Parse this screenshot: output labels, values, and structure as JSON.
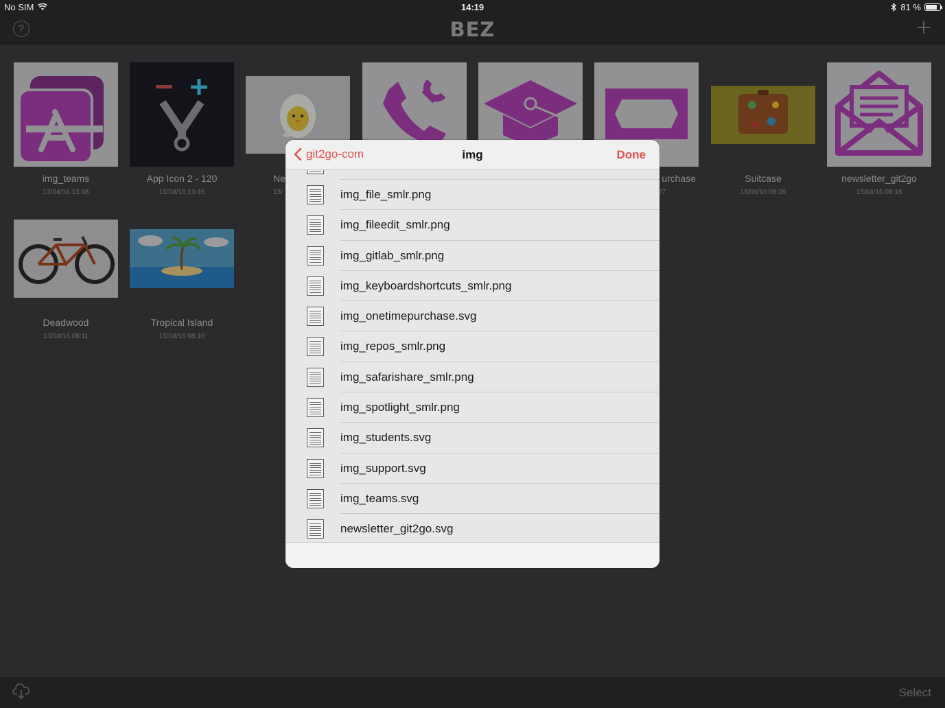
{
  "status_bar": {
    "carrier": "No SIM",
    "time": "14:19",
    "battery": "81 %",
    "battery_level": 0.81
  },
  "nav": {
    "logo": "BEZ",
    "help_label": "?"
  },
  "tiles": [
    {
      "name": "img_teams",
      "date": "13/04/16 13:48"
    },
    {
      "name": "App Icon 2 - 120",
      "date": "13/04/16 13:45"
    },
    {
      "name": "Ne",
      "date": "13/"
    },
    {
      "name": "",
      "date": ""
    },
    {
      "name": "",
      "date": ""
    },
    {
      "name": "urchase",
      "date": ":27"
    },
    {
      "name": "Suitcase",
      "date": "13/04/16 08:26"
    },
    {
      "name": "newsletter_git2go",
      "date": "13/04/16 08:18"
    },
    {
      "name": "Deadwood",
      "date": "13/04/16 08:11"
    },
    {
      "name": "Tropical Island",
      "date": "13/04/16 08:10"
    }
  ],
  "modal": {
    "back_label": "git2go-com",
    "title": "img",
    "done_label": "Done",
    "files": [
      "img_file_smlr.png",
      "img_fileedit_smlr.png",
      "img_gitlab_smlr.png",
      "img_keyboardshortcuts_smlr.png",
      "img_onetimepurchase.svg",
      "img_repos_smlr.png",
      "img_safarishare_smlr.png",
      "img_spotlight_smlr.png",
      "img_students.svg",
      "img_support.svg",
      "img_teams.svg",
      "newsletter_git2go.svg"
    ]
  },
  "bottom_bar": {
    "select_label": "Select"
  },
  "colors": {
    "accent": "#e4524e",
    "tile_purple": "#7b2d7e",
    "background": "#2b2b2e"
  }
}
